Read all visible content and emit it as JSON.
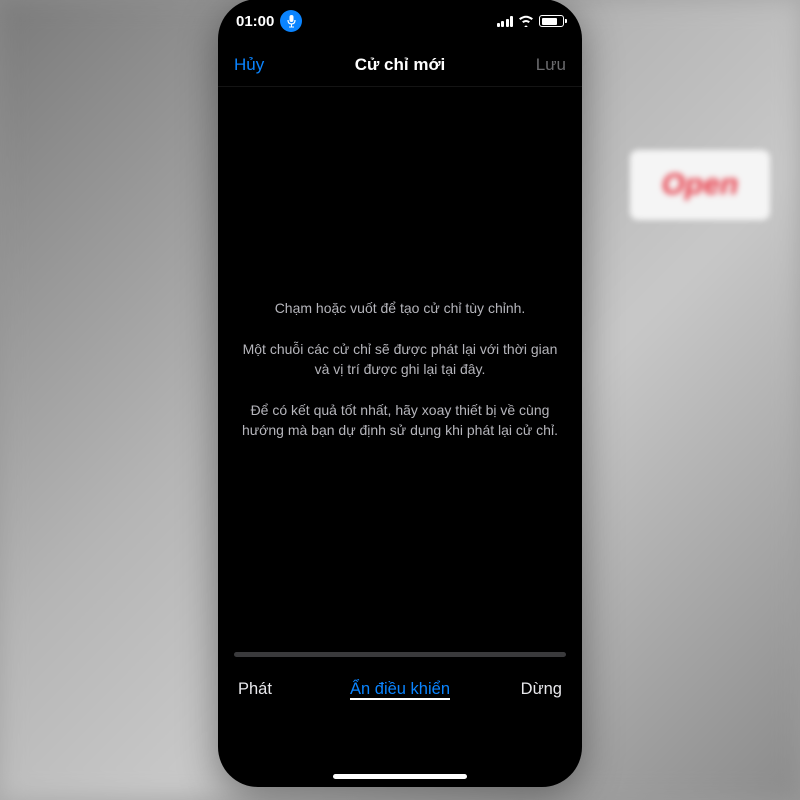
{
  "status_bar": {
    "time": "01:00"
  },
  "nav": {
    "cancel_label": "Hủy",
    "title": "Cử chỉ mới",
    "save_label": "Lưu"
  },
  "content": {
    "hint1": "Chạm hoặc vuốt để tạo cử chỉ tùy chỉnh.",
    "hint2": "Một chuỗi các cử chỉ sẽ được phát lại với thời gian và vị trí được ghi lại tại đây.",
    "hint3": "Để có kết quả tốt nhất, hãy xoay thiết bị về cùng hướng mà bạn dự định sử dụng khi phát lại cử chỉ."
  },
  "toolbar": {
    "play_label": "Phát",
    "hide_controls_label": "Ẩn điều khiển",
    "stop_label": "Dừng"
  },
  "background": {
    "accent_text": "Open"
  }
}
